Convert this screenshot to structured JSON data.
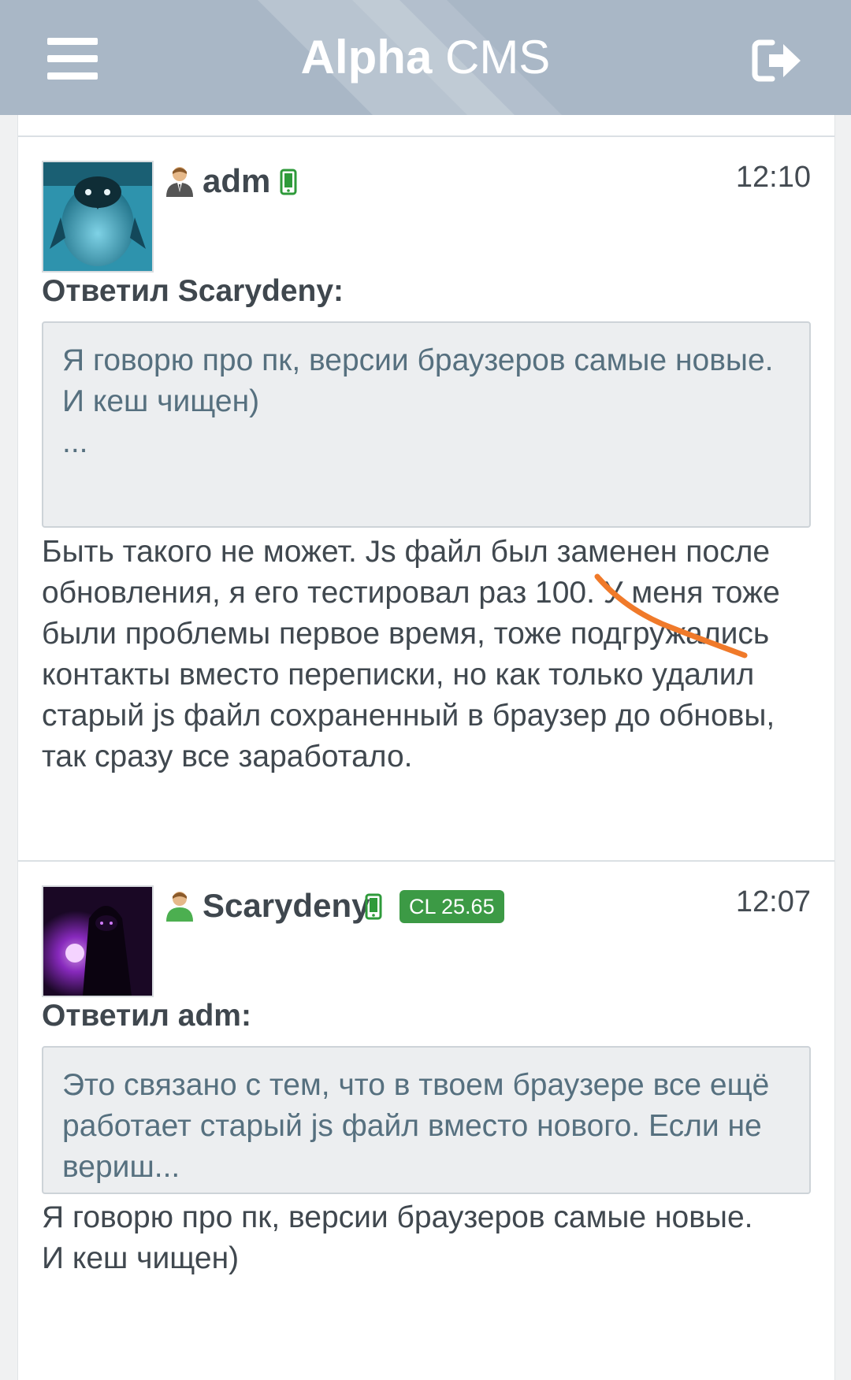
{
  "header": {
    "title_bold": "Alpha",
    "title_regular": "CMS",
    "menu_icon": "hamburger-menu-icon",
    "exit_icon": "sign-out-icon",
    "background": "#a9b7c6"
  },
  "posts": [
    {
      "author": "adm",
      "author_icon": "user-admin-icon",
      "device_icon": "mobile-phone-icon",
      "time": "12:10",
      "reply_to": "Ответил Scarydeny:",
      "quote": "Я говорю про пк, версии браузеров самые новые.\nИ кеш чищен)\n...",
      "body": "Быть такого не может. Js файл был заменен после обновления, я его тестировал раз 100. У меня тоже были проблемы первое время, тоже подгружались контакты вместо переписки, но как только удалил старый js файл сохраненный в браузер до обновы, так сразу все заработало."
    },
    {
      "author": "Scarydeny",
      "author_icon": "user-icon",
      "device_icon": "mobile-phone-icon",
      "badge": "CL 25.65",
      "time": "12:07",
      "reply_to": "Ответил adm:",
      "quote": "Это связано с тем, что в твоем браузере все ещё работает старый js файл вместо нового. Если не вериш...",
      "body": "Я говорю про пк, версии браузеров самые новые.\nИ кеш чищен)"
    }
  ],
  "colors": {
    "badge": "#3c9a45",
    "online_phone": "#2e9a3a",
    "annotation": "#f07a2a"
  }
}
